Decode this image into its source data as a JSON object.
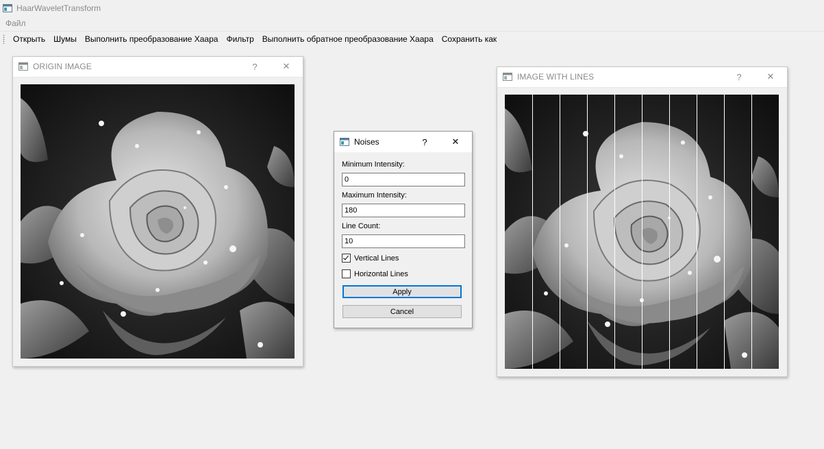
{
  "app": {
    "title": "HaarWaveletTransform",
    "menu": [
      "Файл"
    ]
  },
  "toolbar": {
    "items": [
      "Открыть",
      "Шумы",
      "Выполнить преобразование Хаара",
      "Фильтр",
      "Выполнить обратное преобразование Хаара",
      "Сохранить как"
    ]
  },
  "windows": {
    "origin": {
      "title": "ORIGIN IMAGE",
      "help": "?",
      "close": "✕"
    },
    "lines": {
      "title": "IMAGE WITH LINES",
      "help": "?",
      "close": "✕"
    }
  },
  "dialog": {
    "title": "Noises",
    "help": "?",
    "close": "✕",
    "min_label": "Minimum Intensity:",
    "min_value": "0",
    "max_label": "Maximum Intensity:",
    "max_value": "180",
    "count_label": "Line Count:",
    "count_value": "10",
    "vertical_label": "Vertical Lines",
    "vertical_checked": true,
    "horizontal_label": "Horizontal Lines",
    "horizontal_checked": false,
    "apply_label": "Apply",
    "cancel_label": "Cancel"
  },
  "image": {
    "subject": "grayscale rose with water droplets",
    "overlay_line_count": 10,
    "overlay_orientation": "vertical"
  }
}
